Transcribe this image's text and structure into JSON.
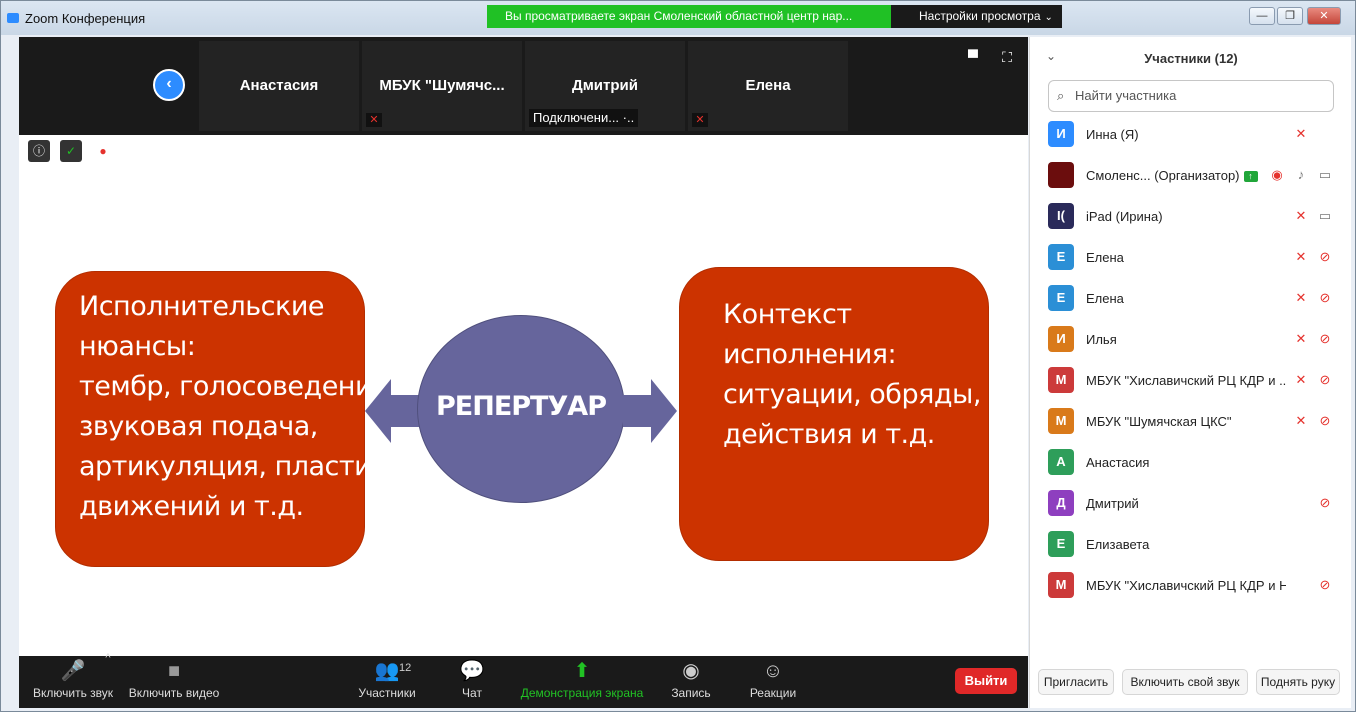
{
  "window": {
    "title": "Zoom Конференция",
    "banner": "Вы просматриваете экран Смоленский областной центр нар...",
    "view_options": "Настройки просмотра",
    "view_options_caret": "⌄",
    "min_icon": "—",
    "restore_icon": "❐",
    "close_icon": "✕"
  },
  "strip": {
    "back_icon": "‹",
    "tiles": [
      {
        "name": "Анастасия"
      },
      {
        "name": "МБУК  \"Шумячс...",
        "muted": "mic-off-icon"
      },
      {
        "name": "Дмитрий",
        "status": "Подключени... ·.."
      },
      {
        "name": "Елена",
        "muted": "mic-off-icon"
      }
    ],
    "mute_glyph": "✕",
    "layout_icon": "▀",
    "fullscreen_icon": "⛶"
  },
  "share_status": {
    "info_icon": "ⓘ",
    "shield_icon": "✓",
    "record_icon": "●"
  },
  "slide": {
    "left_card": "Исполнительские\nнюансы:\nтембр, голосоведение,\nзвуковая подача,\nартикуляция, пластика\nдвижений и т.д.",
    "center": "РЕПЕРТУАР",
    "right_card": "Контекст\nисполнения:\nситуации, обряды,\nдействия и т.д.",
    "card_color": "#cc3300",
    "circle_color": "#66659c"
  },
  "toolbar": {
    "audio": "Включить звук",
    "audio_icon": "🎤",
    "audio_caret": "^",
    "video": "Включить видео",
    "video_icon": "■",
    "participants": "Участники",
    "participants_icon": "👥",
    "participants_count": "12",
    "chat": "Чат",
    "chat_icon": "💬",
    "share": "Демонстрация экрана",
    "share_icon": "⬆",
    "record": "Запись",
    "record_icon": "◉",
    "reactions": "Реакции",
    "reactions_icon": "☺",
    "leave": "Выйти"
  },
  "panel": {
    "title": "Участники (12)",
    "collapse_icon": "⌄",
    "search_icon": "⌕",
    "search_placeholder": "Найти участника",
    "mic_off_glyph": "✕",
    "cam_off_glyph": "⊘",
    "mic_on_glyph": "♪",
    "cam_on_glyph": "▭",
    "rec_glyph": "◉",
    "host_badge": "↑",
    "participants": [
      {
        "initial": "И",
        "color": "#2d8cff",
        "name": "Инна (Я)",
        "mic": "off",
        "cam": ""
      },
      {
        "initial": "",
        "color": "#6b0d0d",
        "name": "Смоленс...  (Организатор)",
        "host": true,
        "rec": true,
        "mic": "on",
        "cam": "on"
      },
      {
        "initial": "I(",
        "color": "#2a2a5a",
        "name": "iPad (Ирина)",
        "mic": "off",
        "cam": "on"
      },
      {
        "initial": "Е",
        "color": "#2b8fd6",
        "name": "Елена",
        "mic": "off",
        "cam": "off"
      },
      {
        "initial": "Е",
        "color": "#2b8fd6",
        "name": "Елена",
        "mic": "off",
        "cam": "off"
      },
      {
        "initial": "И",
        "color": "#d97a1a",
        "name": "Илья",
        "mic": "off",
        "cam": "off"
      },
      {
        "initial": "М",
        "color": "#cc3a3a",
        "name": "МБУК \"Хиславичский РЦ КДР и ...",
        "mic": "off",
        "cam": "off"
      },
      {
        "initial": "М",
        "color": "#d97a1a",
        "name": "МБУК \"Шумячская ЦКС\"",
        "mic": "off",
        "cam": "off"
      },
      {
        "initial": "А",
        "color": "#2e9e5a",
        "name": "Анастасия",
        "mic": "",
        "cam": ""
      },
      {
        "initial": "Д",
        "color": "#8e3fbf",
        "name": "Дмитрий",
        "mic": "",
        "cam": "off"
      },
      {
        "initial": "Е",
        "color": "#2e9e5a",
        "name": "Елизавета",
        "mic": "",
        "cam": ""
      },
      {
        "initial": "М",
        "color": "#cc3a3a",
        "name": "МБУК \"Хиславичский РЦ КДР и НТ\"",
        "mic": "",
        "cam": "off"
      }
    ],
    "footer": {
      "invite": "Пригласить",
      "unmute": "Включить свой звук",
      "raise_hand": "Поднять руку"
    }
  }
}
